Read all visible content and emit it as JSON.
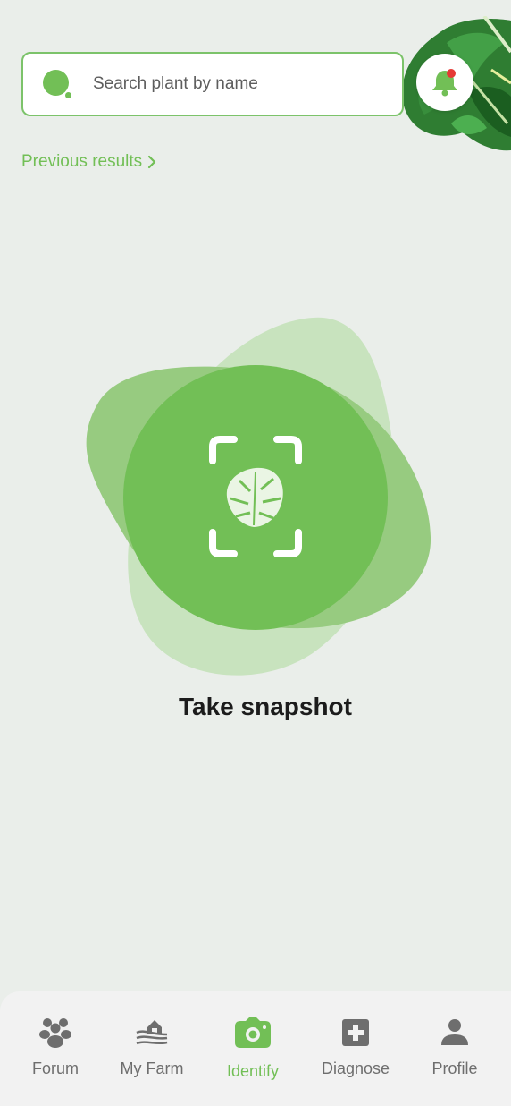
{
  "search": {
    "placeholder": "Search plant by name"
  },
  "notifications": {
    "has_unread": true,
    "badge_color": "#E53935"
  },
  "previous_results": {
    "label": "Previous results"
  },
  "snapshot": {
    "label": "Take snapshot"
  },
  "nav": {
    "items": [
      {
        "label": "Forum",
        "icon": "forum-icon",
        "active": false
      },
      {
        "label": "My Farm",
        "icon": "farm-icon",
        "active": false
      },
      {
        "label": "Identify",
        "icon": "camera-icon",
        "active": true
      },
      {
        "label": "Diagnose",
        "icon": "diagnose-icon",
        "active": false
      },
      {
        "label": "Profile",
        "icon": "profile-icon",
        "active": false
      }
    ]
  },
  "colors": {
    "accent": "#72BF56",
    "accent_light": "#C8E3BE",
    "background": "#EAEEEA",
    "inactive": "#6E6E6E"
  }
}
